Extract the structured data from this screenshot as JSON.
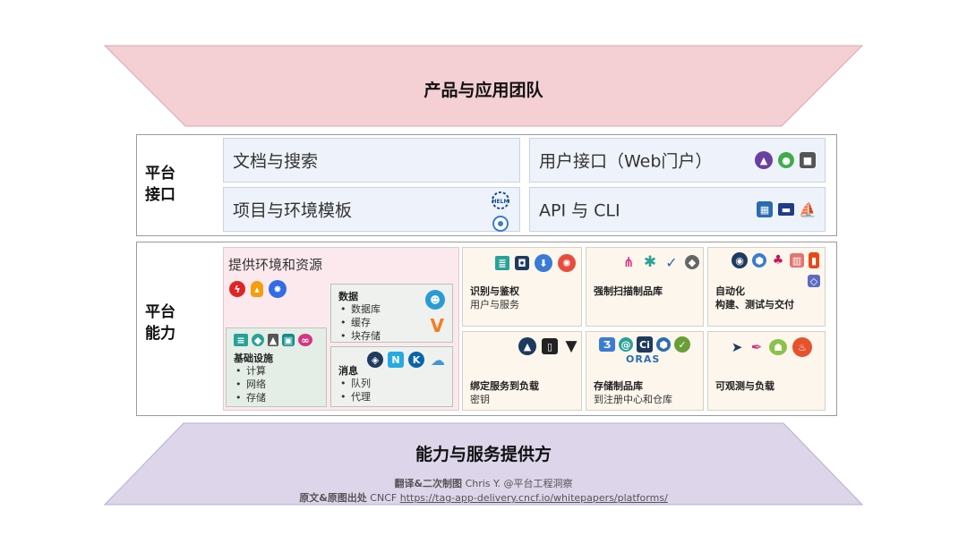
{
  "top_band": {
    "title": "产品与应用团队"
  },
  "bottom_band": {
    "title": "能力与服务提供方"
  },
  "platform_interface": {
    "label_line1": "平台",
    "label_line2": "接口",
    "cells": {
      "docs": "文档与搜索",
      "portal": "用户接口（Web门户）",
      "templates": "项目与环境模板",
      "api": "API 与 CLI"
    },
    "helm_text": "HELM"
  },
  "platform_capabilities": {
    "label_line1": "平台",
    "label_line2": "能力",
    "provision": {
      "title": "提供环境和资源"
    },
    "data": {
      "title": "数据",
      "items": [
        "数据库",
        "缓存",
        "块存储"
      ]
    },
    "infra": {
      "title": "基础设施",
      "items": [
        "计算",
        "网络",
        "存储"
      ]
    },
    "messaging": {
      "title": "消息",
      "items": [
        "队列",
        "代理"
      ]
    },
    "identity": {
      "title": "识别与鉴权",
      "subtitle": "用户与服务"
    },
    "scanning": {
      "title": "强制扫描制品库"
    },
    "automation": {
      "title": "自动化",
      "subtitle": "构建、测试与交付"
    },
    "binding": {
      "title": "绑定服务到负载",
      "subtitle": "密钥"
    },
    "artifact_storage": {
      "title": "存储制品库",
      "subtitle": "到注册中心和仓库"
    },
    "observability": {
      "title": "可观测与负载"
    },
    "oras_text": "ORAS"
  },
  "footer": {
    "line1_label": "翻译&二次制图",
    "line1_author": "Chris Y. @平台工程洞察",
    "line2_label": "原文&原图出处",
    "line2_source": "CNCF",
    "line2_link": "https://tag-app-delivery.cncf.io/whitepapers/platforms/"
  },
  "colors": {
    "top_band": "#f4cfd3",
    "bottom_band": "#ddd5ea",
    "interface_cell": "#eef3fb",
    "capability_cell": "#fdf6ec",
    "provision_cell": "#fbe9ee",
    "infra_cell": "#e4eee6"
  }
}
